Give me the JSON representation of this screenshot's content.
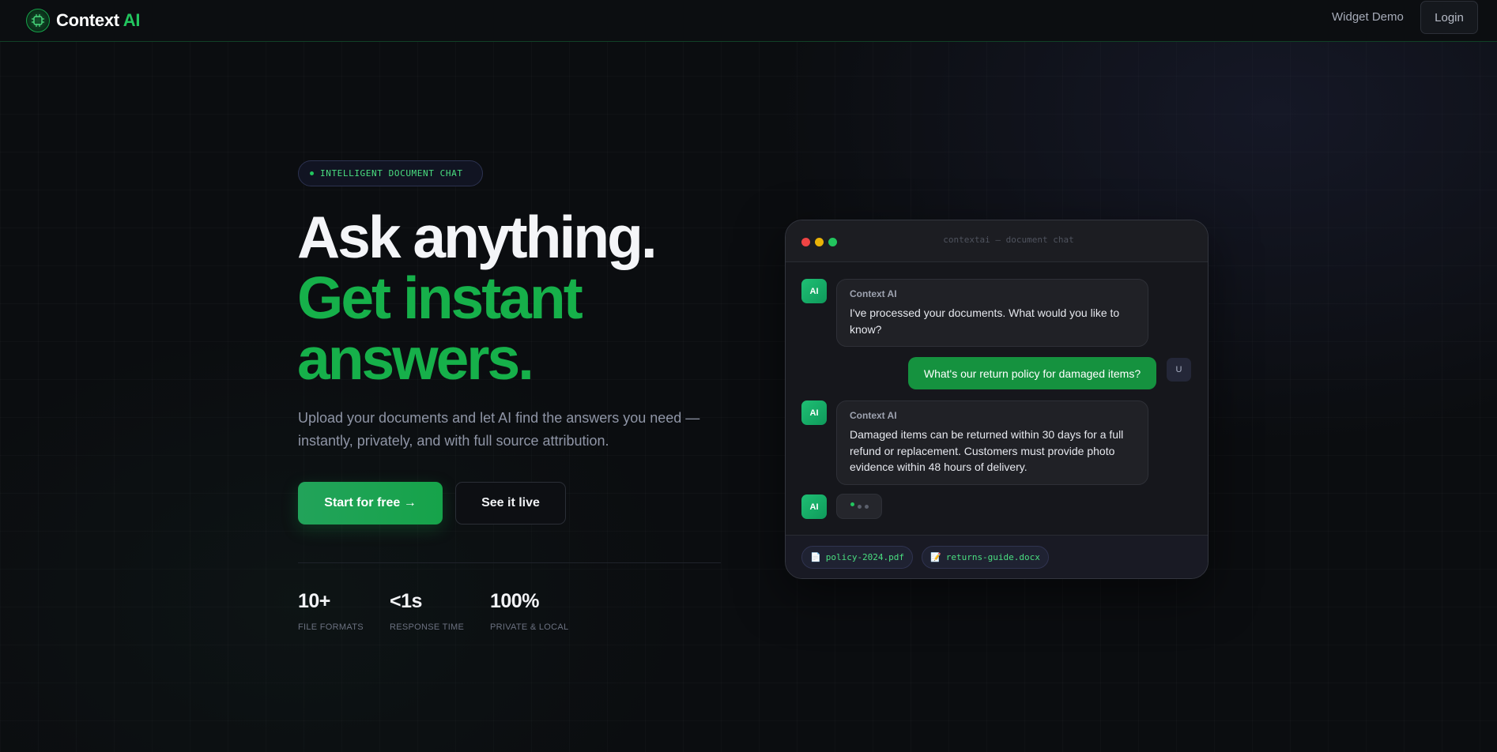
{
  "nav": {
    "logo_icon": "circuit-logo-icon",
    "logo_text": "Context",
    "logo_accent": "AI",
    "links": [
      "Widget Demo"
    ],
    "login_label": "Login"
  },
  "hero": {
    "badge": "INTELLIGENT DOCUMENT CHAT",
    "headline_line1": "Ask anything.",
    "headline_line2": "Get instant answers.",
    "subtext": "Upload your documents and let AI find the answers you need — instantly, privately, and with full source attribution.",
    "primary_cta": "Start for free →",
    "secondary_cta": "See it live",
    "stats": [
      {
        "value": "10+",
        "label": "FILE FORMATS"
      },
      {
        "value": "<1s",
        "label": "RESPONSE TIME"
      },
      {
        "value": "100%",
        "label": "PRIVATE & LOCAL"
      }
    ]
  },
  "chat_window": {
    "title": "contextai — document chat",
    "messages": [
      {
        "role": "ai",
        "avatar": "AI",
        "sender": "Context AI",
        "text": "I've processed your documents. What would you like to know?"
      },
      {
        "role": "user",
        "avatar": "U",
        "text": "What's our return policy for damaged items?"
      },
      {
        "role": "ai",
        "avatar": "AI",
        "sender": "Context AI",
        "text": "Damaged items can be returned within 30 days for a full refund or replacement. Customers must provide photo evidence within 48 hours of delivery."
      },
      {
        "role": "ai-typing",
        "avatar": "AI"
      }
    ],
    "files": [
      {
        "icon": "document-icon",
        "name": "policy-2024.pdf"
      },
      {
        "icon": "memo-icon",
        "name": "returns-guide.docx"
      }
    ]
  },
  "colors": {
    "accent": "#22c55e",
    "background": "#0b0d10",
    "user_bubble": "#15923f"
  }
}
